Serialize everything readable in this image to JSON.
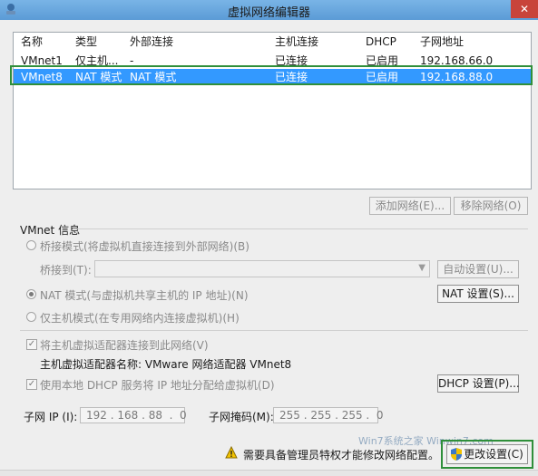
{
  "window": {
    "title": "虚拟网络编辑器",
    "close_label": "✕"
  },
  "table": {
    "headers": [
      "名称",
      "类型",
      "外部连接",
      "主机连接",
      "DHCP",
      "子网地址"
    ],
    "rows": [
      [
        "VMnet1",
        "仅主机...",
        "-",
        "已连接",
        "已启用",
        "192.168.66.0"
      ],
      [
        "VMnet8",
        "NAT 模式",
        "NAT 模式",
        "已连接",
        "已启用",
        "192.168.88.0"
      ]
    ],
    "selected_row": 1
  },
  "list_buttons": {
    "add": "添加网络(E)...",
    "remove": "移除网络(O)"
  },
  "vmnet_info": {
    "group_label": "VMnet 信息",
    "bridge_radio": "桥接模式(将虚拟机直接连接到外部网络)(B)",
    "bridge_to_label": "桥接到(T):",
    "bridge_to_value": "",
    "auto_settings": "自动设置(U)...",
    "nat_radio": "NAT 模式(与虚拟机共享主机的 IP 地址)(N)",
    "nat_settings": "NAT 设置(S)...",
    "hostonly_radio": "仅主机模式(在专用网络内连接虚拟机)(H)",
    "connect_adapter_check": "将主机虚拟适配器连接到此网络(V)",
    "adapter_name_text": "主机虚拟适配器名称: VMware 网络适配器 VMnet8",
    "dhcp_check": "使用本地 DHCP 服务将 IP 地址分配给虚拟机(D)",
    "dhcp_settings": "DHCP 设置(P)...",
    "subnet_ip_label": "子网 IP (I):",
    "subnet_ip_value": "192 . 168 . 88  .  0",
    "subnet_mask_label": "子网掩码(M):",
    "subnet_mask_value": "255 . 255 . 255 .  0",
    "selected_mode": "nat",
    "connect_adapter": true,
    "use_dhcp": true
  },
  "footer": {
    "admin_notice": "需要具备管理员特权才能修改网络配置。",
    "change_settings": "更改设置(C)",
    "watermark": "Win7系统之家 Winwin7.com"
  },
  "colors": {
    "selection": "#3399ff",
    "highlight_box": "#2f8f3a",
    "close": "#c8443a"
  }
}
